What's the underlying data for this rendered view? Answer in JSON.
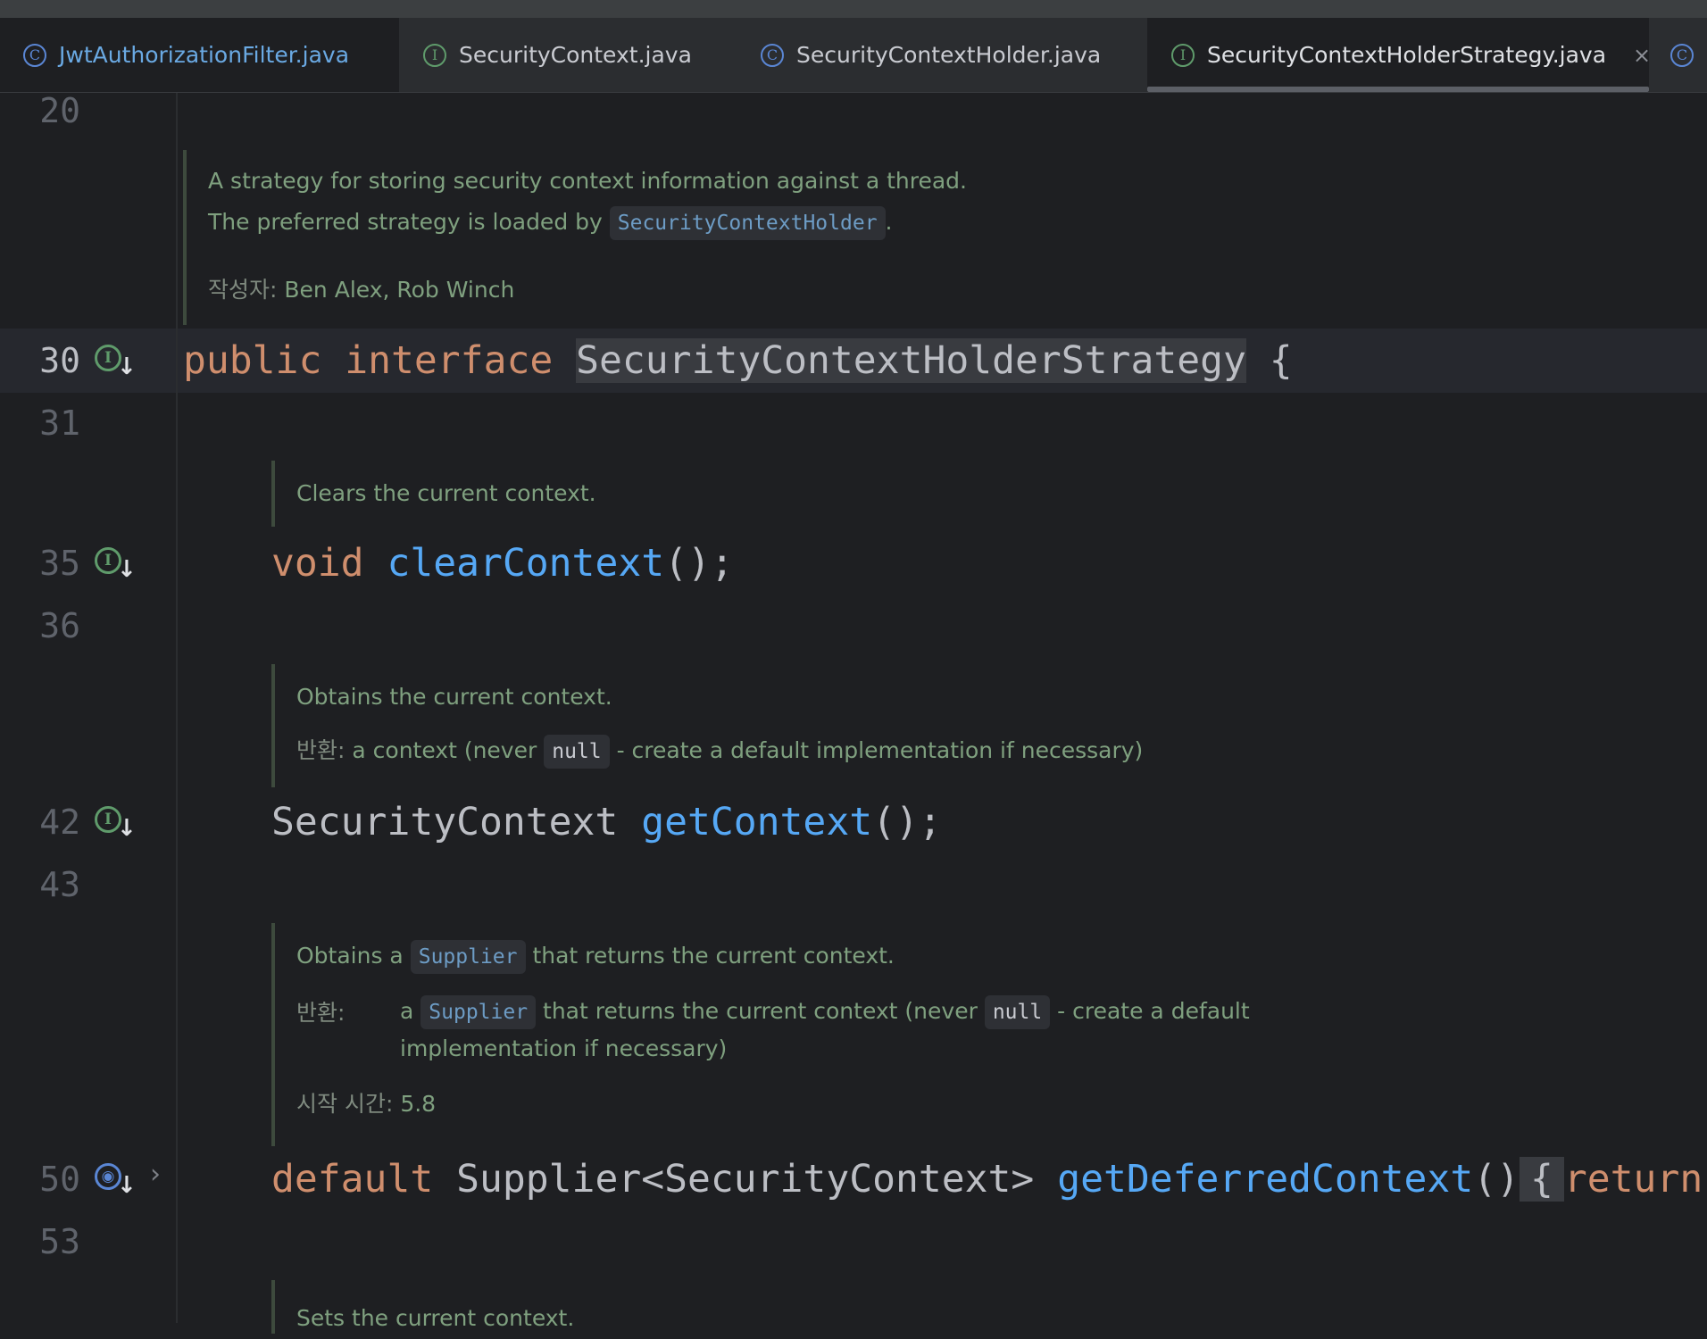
{
  "tabs": [
    {
      "name": "JwtAuthorizationFilter.java",
      "icon": "class-icon",
      "symbol": "C"
    },
    {
      "name": "SecurityContext.java",
      "icon": "interface-icon",
      "symbol": "I"
    },
    {
      "name": "SecurityContextHolder.java",
      "icon": "class-icon",
      "symbol": "C"
    },
    {
      "name": "SecurityContextHolderStrategy.java",
      "icon": "interface-icon",
      "symbol": "I",
      "close": "×"
    },
    {
      "icon": "class-icon",
      "symbol": "C"
    }
  ],
  "lines": {
    "l20": "20",
    "l30": "30",
    "l31": "31",
    "l35": "35",
    "l36": "36",
    "l42": "42",
    "l43": "43",
    "l50": "50",
    "l53": "53"
  },
  "docs": {
    "class_doc": {
      "line1": "A strategy for storing security context information against a thread.",
      "line2_pre": "The preferred strategy is loaded by",
      "line2_code": "SecurityContextHolder",
      "line2_post": ".",
      "author_tag": "작성자:",
      "author_val": "Ben Alex, Rob Winch"
    },
    "clear_doc": {
      "line1": "Clears the current context."
    },
    "get_doc": {
      "line1": "Obtains the current context.",
      "ret_tag": "반환:",
      "ret_pre": "a context (never",
      "ret_code": "null",
      "ret_post": "- create a default implementation if necessary)"
    },
    "deferred_doc": {
      "l1_pre": "Obtains a",
      "l1_code": "Supplier",
      "l1_post": "that returns the current context.",
      "ret_tag": "반환:",
      "ret_a": "a",
      "ret_code1": "Supplier",
      "ret_mid": "that returns the current context (never",
      "ret_code2": "null",
      "ret_post": "- create a default",
      "ret_line2": "implementation if necessary)",
      "since_tag": "시작 시간:",
      "since_val": "5.8"
    },
    "set_doc": {
      "line1": "Sets the current context."
    }
  },
  "code": {
    "decl": {
      "kw1": "public",
      "kw2": "interface",
      "name": "SecurityContextHolderStrategy",
      "brace": "{"
    },
    "clear": {
      "kw": "void",
      "fn": "clearContext",
      "tail": "();"
    },
    "get": {
      "type": "SecurityContext",
      "fn": "getContext",
      "tail": "();"
    },
    "deferred": {
      "kw": "default",
      "type": "Supplier<SecurityContext>",
      "fn": "getDeferredContext",
      "parens": "()",
      "brace": "{",
      "ret": "return"
    }
  }
}
